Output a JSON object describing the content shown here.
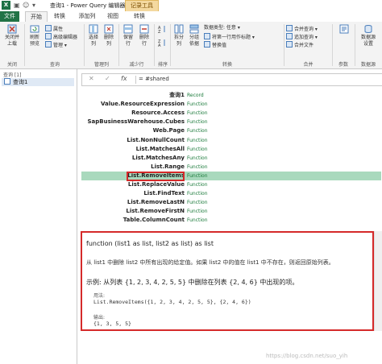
{
  "titlebar": {
    "app_icon": "X",
    "title": "查询1 - Power Query 编辑器",
    "context_tab": "记录工具"
  },
  "tabs": [
    "文件",
    "开始",
    "转换",
    "添加列",
    "视图",
    "转换"
  ],
  "ribbon": {
    "close_upload": "关闭并\n上载",
    "refresh_preview": "刷新\n预览",
    "properties": "属性",
    "advanced_editor": "高级编辑器",
    "manage": "管理",
    "choose_cols": "选择\n列",
    "remove_cols": "删除\n列",
    "keep_rows": "保留\n行",
    "remove_rows": "删除\n行",
    "split_col": "拆分\n列",
    "group_by": "分组\n依据",
    "data_type": "数据类型: 任意",
    "first_row_header": "将第一行用作标题",
    "replace_values": "替换值",
    "merge_queries": "合并查询",
    "append_queries": "追加查询",
    "merge_files": "合并文件",
    "data_source_settings": "数据源\n设置",
    "groups": {
      "close": "关闭",
      "query": "查询",
      "manage_cols": "管理列",
      "reduce_rows": "减少行",
      "sort": "排序",
      "transform": "转换",
      "combine": "合并",
      "param": "参数",
      "data_source": "数据源"
    }
  },
  "queries_pane": {
    "header": "查询 [1]",
    "items": [
      "查询1"
    ]
  },
  "formula_bar": {
    "cancel": "✕",
    "confirm": "✓",
    "fx": "fx",
    "text": "= #shared"
  },
  "grid_rows": [
    {
      "key": "查询1",
      "value": "Record"
    },
    {
      "key": "Value.ResourceExpression",
      "value": "Function"
    },
    {
      "key": "Resource.Access",
      "value": "Function"
    },
    {
      "key": "SapBusinessWarehouse.Cubes",
      "value": "Function"
    },
    {
      "key": "Web.Page",
      "value": "Function"
    },
    {
      "key": "List.NonNullCount",
      "value": "Function"
    },
    {
      "key": "List.MatchesAll",
      "value": "Function"
    },
    {
      "key": "List.MatchesAny",
      "value": "Function"
    },
    {
      "key": "List.Range",
      "value": "Function"
    },
    {
      "key": "List.RemoveItems",
      "value": "Function"
    },
    {
      "key": "List.ReplaceValue",
      "value": "Function"
    },
    {
      "key": "List.FindText",
      "value": "Function"
    },
    {
      "key": "List.RemoveLastN",
      "value": "Function"
    },
    {
      "key": "List.RemoveFirstN",
      "value": "Function"
    },
    {
      "key": "Table.ColumnCount",
      "value": "Function"
    }
  ],
  "selected_row_index": 9,
  "detail": {
    "signature": "function (list1 as list, list2 as list) as list",
    "description": "从 list1 中删除 list2 中所有出现的给定值。如果 list2 中的值在 list1 中不存在，则返回原始列表。",
    "example_title": "示例: 从列表 {1, 2, 3, 4, 2, 5, 5} 中删除在列表 {2, 4, 6} 中出现的项。",
    "usage_label": "用法:",
    "usage_code": "List.RemoveItems({1, 2, 3, 4, 2, 5, 5}, {2, 4, 6})",
    "output_label": "输出:",
    "output_code": "{1, 3, 5, 5}"
  },
  "watermark": "https://blog.csdn.net/suo_yih",
  "colors": {
    "excel_green": "#217346",
    "selection": "#a9d9bd",
    "highlight_red": "#d52a2a",
    "function_text": "#1a7a3a"
  }
}
